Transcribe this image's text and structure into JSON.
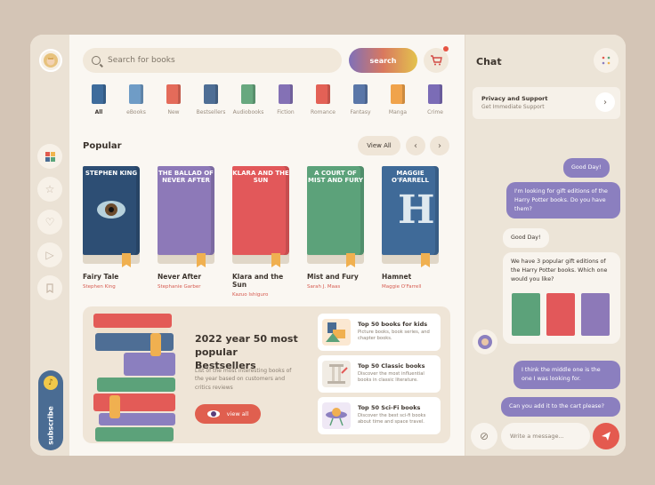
{
  "search": {
    "placeholder": "Search for books",
    "button_label": "search"
  },
  "categories": [
    {
      "label": "All",
      "color": "#3e6c9c"
    },
    {
      "label": "eBooks",
      "color": "#6f9cc6"
    },
    {
      "label": "New",
      "color": "#e46b5a"
    },
    {
      "label": "Bestsellers",
      "color": "#4e6e95"
    },
    {
      "label": "Audiobooks",
      "color": "#68a87f"
    },
    {
      "label": "Fiction",
      "color": "#8471b5"
    },
    {
      "label": "Romance",
      "color": "#e36156"
    },
    {
      "label": "Fantasy",
      "color": "#5a77a8"
    },
    {
      "label": "Manga",
      "color": "#f0a34b"
    },
    {
      "label": "Crime",
      "color": "#7b6cb6"
    }
  ],
  "popular": {
    "title": "Popular",
    "view_all": "View All",
    "books": [
      {
        "title": "Fairy Tale",
        "author": "Stephen King",
        "cover_text": "STEPHEN KING",
        "color": "#2d4e74"
      },
      {
        "title": "Never After",
        "author": "Stephanie Garber",
        "cover_text": "THE BALLAD OF NEVER AFTER",
        "color": "#8d79b8"
      },
      {
        "title": "Klara and the Sun",
        "author": "Kazuo Ishiguro",
        "cover_text": "KLARA AND THE SUN",
        "color": "#e2585a"
      },
      {
        "title": "Mist and Fury",
        "author": "Sarah J. Maas",
        "cover_text": "A COURT OF MIST AND FURY",
        "color": "#5ca27a"
      },
      {
        "title": "Hamnet",
        "author": "Maggie O'Farrell",
        "cover_text": "MAGGIE O'FARRELL",
        "color": "#3f6a98"
      }
    ]
  },
  "banner": {
    "title": "2022 year 50 most popular Bestsellers",
    "description": "List of the most interesting books of the year based on customers and critics reviews",
    "button": "view all",
    "cards": [
      {
        "title": "Top 50 books for kids",
        "desc": "Picture books, book series, and chapter books."
      },
      {
        "title": "Top 50 Classic books",
        "desc": "Discover the most influential books in classic literature."
      },
      {
        "title": "Top 50 Sci-Fi books",
        "desc": "Discover the best sci-fi books about time and space travel."
      }
    ]
  },
  "sidebar": {
    "subscribe": "subscribe"
  },
  "chat": {
    "title": "Chat",
    "support_title": "Privacy and Support",
    "support_sub": "Get Immediate Support",
    "messages": [
      {
        "text": "Good Day!",
        "dir": "out"
      },
      {
        "text": "I'm looking for gift editions of the Harry Potter books. Do you have them?",
        "dir": "out"
      },
      {
        "text": "Good Day!",
        "dir": "in"
      },
      {
        "text": "We have 3 popular gift editions of the Harry Potter books. Which one would you like?",
        "dir": "in"
      },
      {
        "text": "I think the middle one is the one I was looking for.",
        "dir": "out"
      },
      {
        "text": "Can you add it to the cart please?",
        "dir": "out"
      }
    ],
    "input_placeholder": "Write a message..."
  }
}
